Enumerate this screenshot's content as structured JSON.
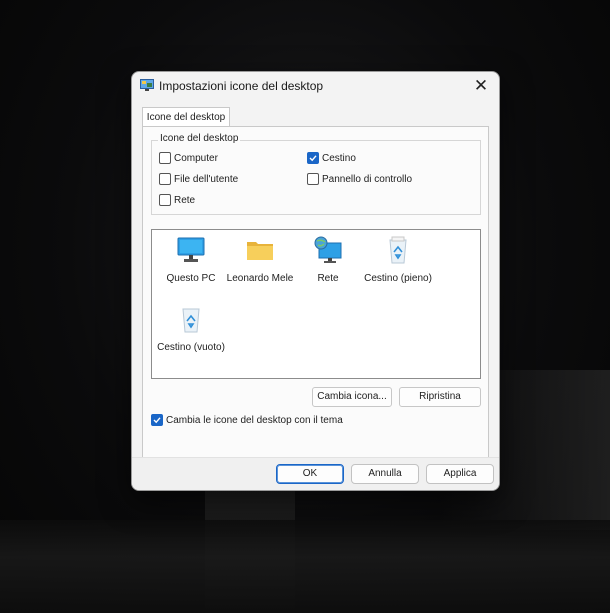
{
  "dialog": {
    "title": "Impostazioni icone del desktop",
    "close": "✕",
    "tab": "Icone del desktop"
  },
  "group": {
    "legend": "Icone del desktop",
    "checkboxes": [
      {
        "label": "Computer",
        "checked": false
      },
      {
        "label": "Cestino",
        "checked": true
      },
      {
        "label": "File dell'utente",
        "checked": false
      },
      {
        "label": "Pannello di controllo",
        "checked": false
      },
      {
        "label": "Rete",
        "checked": false
      }
    ]
  },
  "icons": [
    {
      "label": "Questo PC",
      "icon": "monitor-icon"
    },
    {
      "label": "Leonardo Mele",
      "icon": "folder-icon"
    },
    {
      "label": "Rete",
      "icon": "network-icon"
    },
    {
      "label": "Cestino (pieno)",
      "icon": "recycle-bin-full-icon"
    },
    {
      "label": "Cestino (vuoto)",
      "icon": "recycle-bin-empty-icon"
    }
  ],
  "buttons": {
    "change_icon": "Cambia icona...",
    "restore": "Ripristina"
  },
  "theme_checkbox": {
    "label": "Cambia le icone del desktop con il tema",
    "checked": true
  },
  "footer": {
    "ok": "OK",
    "cancel": "Annulla",
    "apply": "Applica"
  },
  "colors": {
    "accent": "#1a66c7",
    "dialog_bg": "#f3f3f3",
    "desktop_bg": "#0b0b0c"
  }
}
